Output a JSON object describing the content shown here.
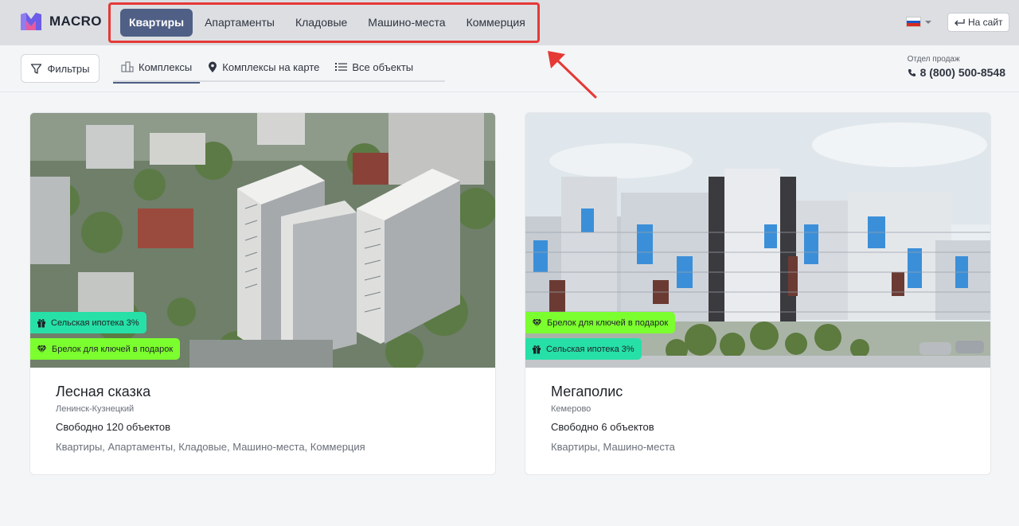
{
  "brand": {
    "name": "MACRO"
  },
  "nav": {
    "items": [
      {
        "label": "Квартиры",
        "active": true
      },
      {
        "label": "Апартаменты",
        "active": false
      },
      {
        "label": "Кладовые",
        "active": false
      },
      {
        "label": "Машино-места",
        "active": false
      },
      {
        "label": "Коммерция",
        "active": false
      }
    ]
  },
  "header": {
    "lang_icon": "russia-flag-icon",
    "site_button": "На сайт"
  },
  "toolbar": {
    "filters_label": "Фильтры",
    "tabs": [
      {
        "label": "Комплексы",
        "icon": "buildings-icon",
        "active": true
      },
      {
        "label": "Комплексы на карте",
        "icon": "map-pin-icon",
        "active": false
      },
      {
        "label": "Все объекты",
        "icon": "list-icon",
        "active": false
      }
    ],
    "sales_label": "Отдел продаж",
    "sales_phone": "8 (800) 500-8548"
  },
  "cards": [
    {
      "title": "Лесная сказка",
      "city": "Ленинск-Кузнецкий",
      "free": "Свободно 120 объектов",
      "types": "Квартиры, Апартаменты, Кладовые, Машино-места, Коммерция",
      "badges": [
        {
          "label": "Сельская ипотека 3%",
          "icon": "gift-icon",
          "color": "#26e0a8"
        },
        {
          "label": "Брелок для ключей в подарок",
          "icon": "diamond-icon",
          "color": "#7cff2e"
        }
      ]
    },
    {
      "title": "Мегаполис",
      "city": "Кемерово",
      "free": "Свободно 6 объектов",
      "types": "Квартиры, Машино-места",
      "badges": [
        {
          "label": "Брелок для ключей в подарок",
          "icon": "diamond-icon",
          "color": "#7cff2e"
        },
        {
          "label": "Сельская ипотека 3%",
          "icon": "gift-icon",
          "color": "#26e0a8"
        }
      ]
    }
  ],
  "colors": {
    "accent": "#4f5f85",
    "highlight_frame": "#e53935",
    "badge_mint": "#26e0a8",
    "badge_lime": "#7cff2e"
  }
}
